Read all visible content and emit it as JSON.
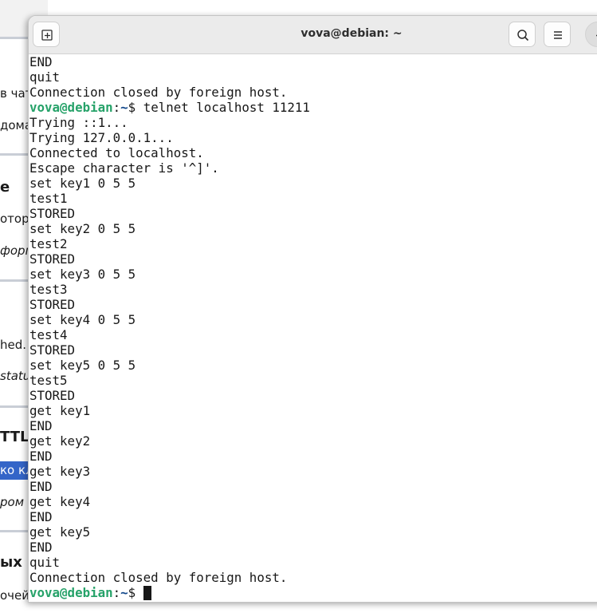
{
  "background_page": {
    "lines": [
      {
        "text": "в чат",
        "style": "normal"
      },
      {
        "text": "дома",
        "style": "normal"
      },
      {
        "text": "e",
        "style": "bold"
      },
      {
        "text": "оторы",
        "style": "normal"
      },
      {
        "text": "форм",
        "style": "italic"
      },
      {
        "text": "hed.",
        "style": "normal"
      },
      {
        "text": "statu",
        "style": "italic"
      },
      {
        "text": "TTL",
        "style": "bold"
      },
      {
        "text": "ко кл",
        "style": "highlight"
      },
      {
        "text": "ром в",
        "style": "italic"
      },
      {
        "text": "ых в",
        "style": "bold"
      },
      {
        "text": "очей",
        "style": "normal"
      }
    ]
  },
  "terminal": {
    "title": "vova@debian: ~",
    "header_icons": {
      "new_tab": "new-tab-icon",
      "search": "search-icon",
      "menu": "hamburger-menu-icon",
      "minimize": "minimize-icon"
    },
    "prompt": {
      "user_host": "vova@debian",
      "separator": ":",
      "path": "~",
      "symbol": "$ "
    },
    "colors": {
      "user_host": "#26a269",
      "path": "#12488b",
      "text": "#171717",
      "background": "#ffffff"
    },
    "lines": [
      {
        "type": "output",
        "text": "END"
      },
      {
        "type": "output",
        "text": "quit"
      },
      {
        "type": "output",
        "text": "Connection closed by foreign host."
      },
      {
        "type": "prompt",
        "command": "telnet localhost 11211"
      },
      {
        "type": "output",
        "text": "Trying ::1..."
      },
      {
        "type": "output",
        "text": "Trying 127.0.0.1..."
      },
      {
        "type": "output",
        "text": "Connected to localhost."
      },
      {
        "type": "output",
        "text": "Escape character is '^]'."
      },
      {
        "type": "output",
        "text": "set key1 0 5 5"
      },
      {
        "type": "output",
        "text": "test1"
      },
      {
        "type": "output",
        "text": "STORED"
      },
      {
        "type": "output",
        "text": "set key2 0 5 5"
      },
      {
        "type": "output",
        "text": "test2"
      },
      {
        "type": "output",
        "text": "STORED"
      },
      {
        "type": "output",
        "text": "set key3 0 5 5"
      },
      {
        "type": "output",
        "text": "test3"
      },
      {
        "type": "output",
        "text": "STORED"
      },
      {
        "type": "output",
        "text": "set key4 0 5 5"
      },
      {
        "type": "output",
        "text": "test4"
      },
      {
        "type": "output",
        "text": "STORED"
      },
      {
        "type": "output",
        "text": "set key5 0 5 5"
      },
      {
        "type": "output",
        "text": "test5"
      },
      {
        "type": "output",
        "text": "STORED"
      },
      {
        "type": "output",
        "text": "get key1"
      },
      {
        "type": "output",
        "text": "END"
      },
      {
        "type": "output",
        "text": "get key2"
      },
      {
        "type": "output",
        "text": "END"
      },
      {
        "type": "output",
        "text": "get key3"
      },
      {
        "type": "output",
        "text": "END"
      },
      {
        "type": "output",
        "text": "get key4"
      },
      {
        "type": "output",
        "text": "END"
      },
      {
        "type": "output",
        "text": "get key5"
      },
      {
        "type": "output",
        "text": "END"
      },
      {
        "type": "output",
        "text": "quit"
      },
      {
        "type": "output",
        "text": "Connection closed by foreign host."
      },
      {
        "type": "prompt",
        "command": "",
        "cursor": true
      }
    ]
  }
}
